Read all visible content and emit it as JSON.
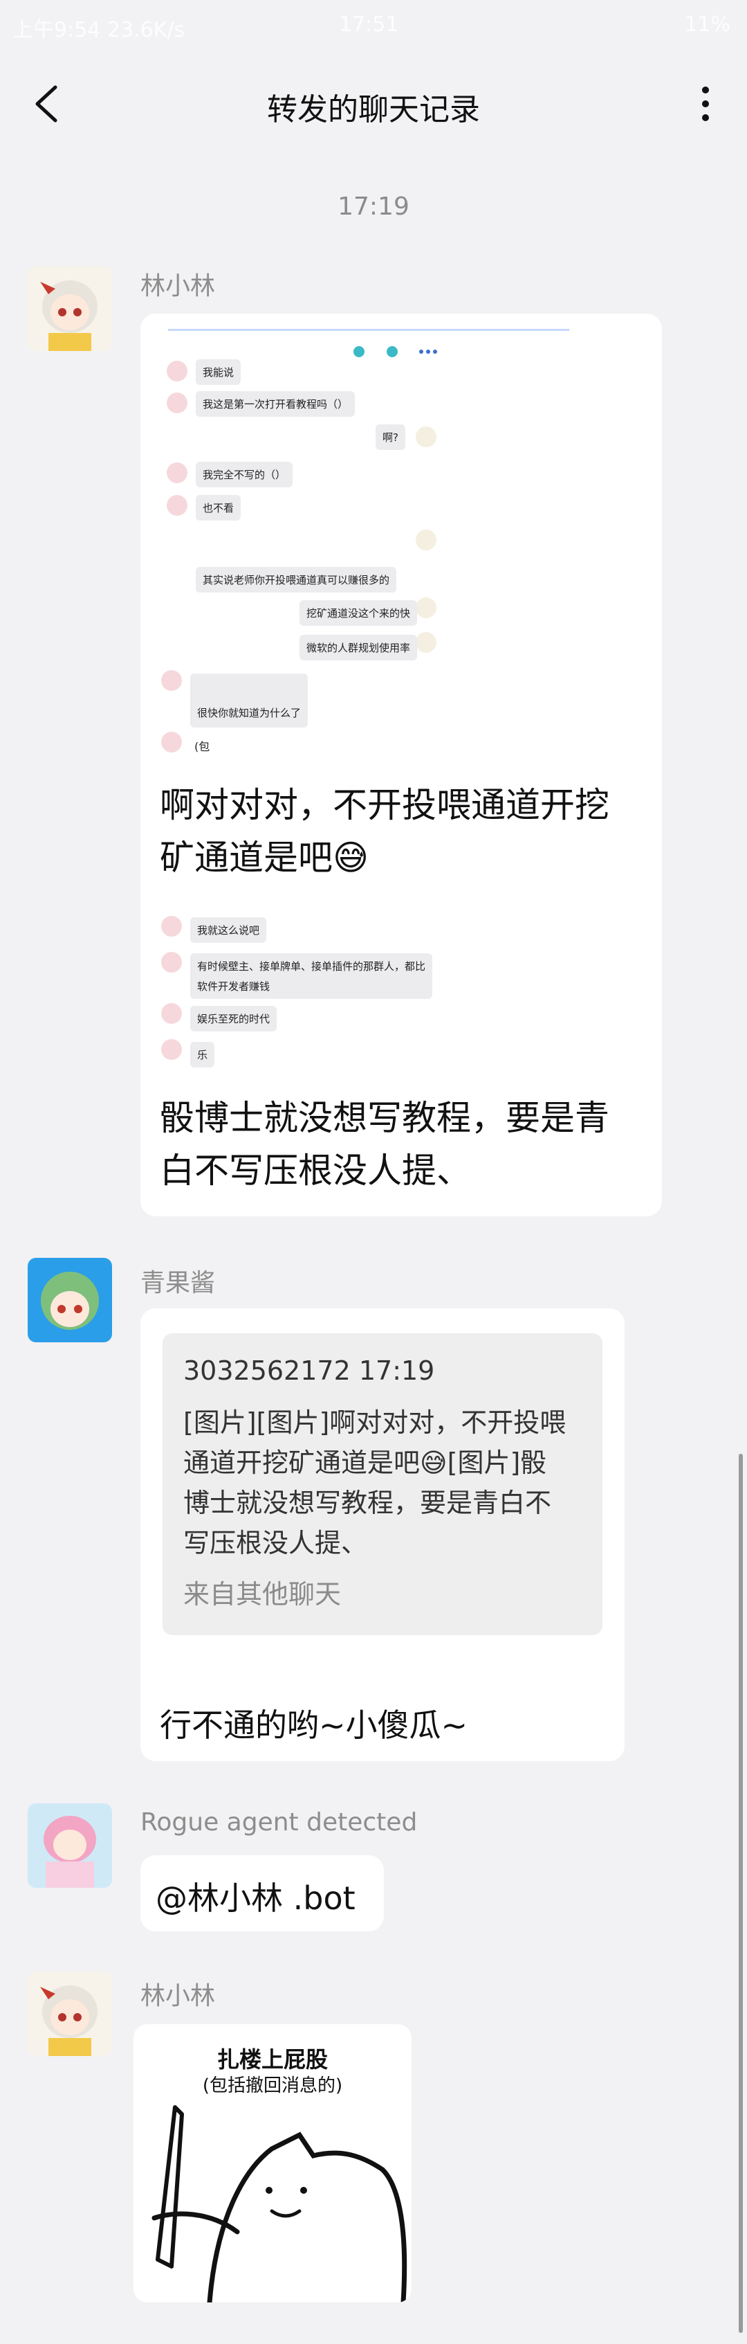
{
  "status": {
    "left": "上午9:54 23.6K/s",
    "time": "17:51",
    "battery": "11%"
  },
  "nav": {
    "title": "转发的聊天记录"
  },
  "timestamp": "17:19",
  "messages": {
    "m1": {
      "sender": "林小林",
      "shot": {
        "rows": [
          "我能说",
          "我这是第一次打开看教程吗（）",
          "啊?",
          "我完全不写的（）",
          "也不看",
          "其实说老师你开投喂通道真可以赚很多的",
          "挖矿通道没这个来的快",
          "微软的人群规划使用率",
          "很快你就知道为什么了",
          "(包"
        ],
        "text1": "啊对对对，不开投喂通道开挖矿通道是吧😅",
        "rows2": [
          "我就这么说吧",
          "有时候壁主、接单牌单、接单插件的那群人，都比",
          "软件开发者赚钱",
          "娱乐至死的时代",
          "乐"
        ],
        "text2": "骰博士就没想写教程，要是青白不写压根没人提、"
      }
    },
    "m2": {
      "sender": "青果酱",
      "quote_head": "3032562172 17:19",
      "quote_body": "[图片][图片]啊对对对，不开投喂通道开挖矿通道是吧😅[图片]骰博士就没想写教程，要是青白不写压根没人提、",
      "quote_from": "来自其他聊天",
      "reply": "行不通的哟~小傻瓜~"
    },
    "m3": {
      "sender": "Rogue agent detected",
      "text": "@林小林 .bot"
    },
    "m4": {
      "sender": "林小林",
      "sticker_title": "扎楼上屁股",
      "sticker_sub": "(包括撤回消息的)"
    }
  }
}
